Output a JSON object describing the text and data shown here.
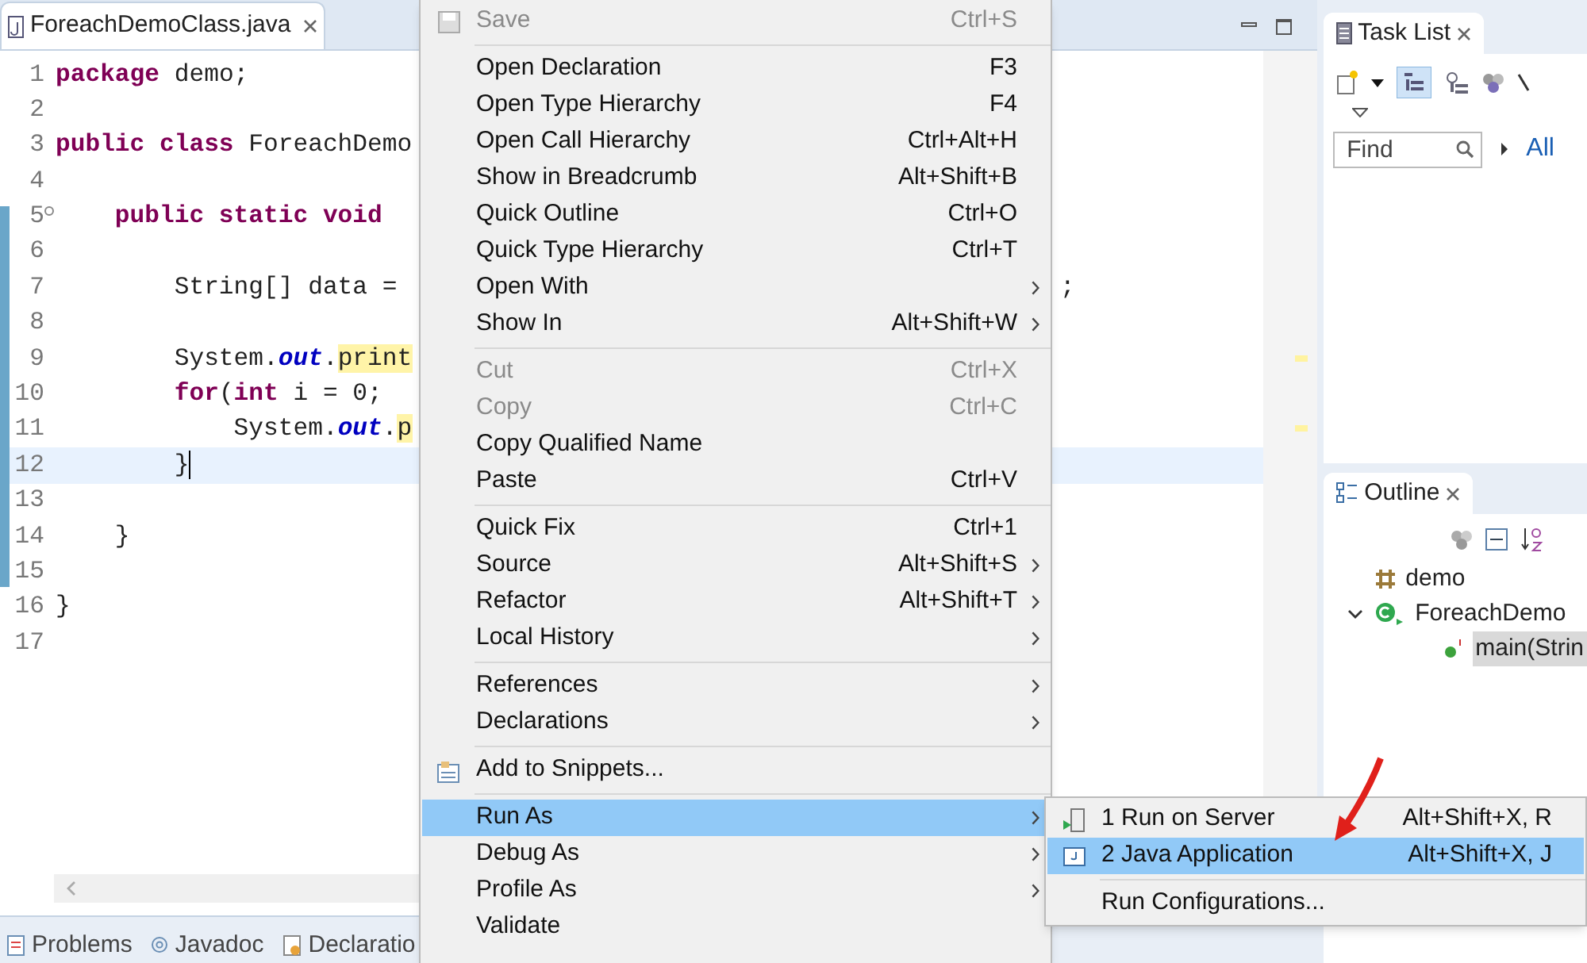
{
  "editor": {
    "tab": {
      "title": "ForeachDemoClass.java",
      "selected": true
    },
    "lines": [
      {
        "number": "1",
        "segments": [
          {
            "kind": "keyword",
            "text": "package"
          },
          {
            "kind": "plain",
            "text": " demo;"
          }
        ]
      },
      {
        "number": "2"
      },
      {
        "number": "3",
        "segments": [
          {
            "kind": "keyword",
            "text": "public class"
          },
          {
            "kind": "plain",
            "text": " ForeachDemo"
          }
        ]
      },
      {
        "number": "4"
      },
      {
        "number": "5",
        "fold": true,
        "segments": [
          {
            "kind": "keyword",
            "text": "    public static void"
          }
        ]
      },
      {
        "number": "6"
      },
      {
        "number": "7",
        "segments": [
          {
            "kind": "plain",
            "text": "        String[] data ="
          }
        ],
        "tail": ";"
      },
      {
        "number": "8"
      },
      {
        "number": "9",
        "segments": [
          {
            "kind": "plain",
            "text": "        System."
          },
          {
            "kind": "field",
            "text": "out"
          },
          {
            "kind": "plain",
            "text": "."
          },
          {
            "kind": "highlight",
            "text": "print"
          }
        ]
      },
      {
        "number": "10",
        "segments": [
          {
            "kind": "keyword",
            "text": "        for"
          },
          {
            "kind": "plain",
            "text": "("
          },
          {
            "kind": "keyword",
            "text": "int"
          },
          {
            "kind": "plain",
            "text": " i = 0;"
          }
        ]
      },
      {
        "number": "11",
        "segments": [
          {
            "kind": "plain",
            "text": "            System."
          },
          {
            "kind": "field",
            "text": "out"
          },
          {
            "kind": "plain",
            "text": "."
          },
          {
            "kind": "highlight",
            "text": "p"
          }
        ]
      },
      {
        "number": "12",
        "current": true,
        "segments": [
          {
            "kind": "plain",
            "text": "        }"
          }
        ]
      },
      {
        "number": "13"
      },
      {
        "number": "14",
        "segments": [
          {
            "kind": "plain",
            "text": "    }"
          }
        ]
      },
      {
        "number": "15"
      },
      {
        "number": "16",
        "segments": [
          {
            "kind": "plain",
            "text": "}"
          }
        ]
      },
      {
        "number": "17"
      }
    ]
  },
  "bottom_tabs": [
    {
      "label": "Problems"
    },
    {
      "label": "Javadoc"
    },
    {
      "label": "Declaratio"
    }
  ],
  "task_list": {
    "title": "Task List",
    "find": {
      "placeholder": "Find"
    },
    "filter_link": "All"
  },
  "outline": {
    "title": "Outline",
    "tree": [
      {
        "label": "demo",
        "kind": "package"
      },
      {
        "label": "ForeachDemo",
        "kind": "class",
        "expanded": true,
        "children": [
          {
            "label": "main(Strin",
            "kind": "method",
            "selected": true
          }
        ]
      }
    ]
  },
  "context_menu": [
    {
      "kind": "item",
      "label": "Save",
      "shortcut": "Ctrl+S",
      "disabled": true,
      "submenu": false,
      "selected": false
    },
    {
      "kind": "separator"
    },
    {
      "kind": "item",
      "label": "Open Declaration",
      "shortcut": "F3",
      "disabled": false,
      "submenu": false,
      "selected": false
    },
    {
      "kind": "item",
      "label": "Open Type Hierarchy",
      "shortcut": "F4",
      "disabled": false,
      "submenu": false,
      "selected": false
    },
    {
      "kind": "item",
      "label": "Open Call Hierarchy",
      "shortcut": "Ctrl+Alt+H",
      "disabled": false,
      "submenu": false,
      "selected": false
    },
    {
      "kind": "item",
      "label": "Show in Breadcrumb",
      "shortcut": "Alt+Shift+B",
      "disabled": false,
      "submenu": false,
      "selected": false
    },
    {
      "kind": "item",
      "label": "Quick Outline",
      "shortcut": "Ctrl+O",
      "disabled": false,
      "submenu": false,
      "selected": false
    },
    {
      "kind": "item",
      "label": "Quick Type Hierarchy",
      "shortcut": "Ctrl+T",
      "disabled": false,
      "submenu": false,
      "selected": false
    },
    {
      "kind": "item",
      "label": "Open With",
      "disabled": false,
      "submenu": true,
      "selected": false
    },
    {
      "kind": "item",
      "label": "Show In",
      "shortcut": "Alt+Shift+W",
      "disabled": false,
      "submenu": true,
      "selected": false
    },
    {
      "kind": "separator"
    },
    {
      "kind": "item",
      "label": "Cut",
      "shortcut": "Ctrl+X",
      "disabled": true,
      "submenu": false,
      "selected": false
    },
    {
      "kind": "item",
      "label": "Copy",
      "shortcut": "Ctrl+C",
      "disabled": true,
      "submenu": false,
      "selected": false
    },
    {
      "kind": "item",
      "label": "Copy Qualified Name",
      "disabled": false,
      "submenu": false,
      "selected": false
    },
    {
      "kind": "item",
      "label": "Paste",
      "shortcut": "Ctrl+V",
      "disabled": false,
      "submenu": false,
      "selected": false
    },
    {
      "kind": "separator"
    },
    {
      "kind": "item",
      "label": "Quick Fix",
      "shortcut": "Ctrl+1",
      "disabled": false,
      "submenu": false,
      "selected": false
    },
    {
      "kind": "item",
      "label": "Source",
      "shortcut": "Alt+Shift+S",
      "disabled": false,
      "submenu": true,
      "selected": false
    },
    {
      "kind": "item",
      "label": "Refactor",
      "shortcut": "Alt+Shift+T",
      "disabled": false,
      "submenu": true,
      "selected": false
    },
    {
      "kind": "item",
      "label": "Local History",
      "disabled": false,
      "submenu": true,
      "selected": false
    },
    {
      "kind": "separator"
    },
    {
      "kind": "item",
      "label": "References",
      "disabled": false,
      "submenu": true,
      "selected": false
    },
    {
      "kind": "item",
      "label": "Declarations",
      "disabled": false,
      "submenu": true,
      "selected": false
    },
    {
      "kind": "separator"
    },
    {
      "kind": "item",
      "label": "Add to Snippets...",
      "disabled": false,
      "submenu": false,
      "selected": false
    },
    {
      "kind": "separator"
    },
    {
      "kind": "item",
      "label": "Run As",
      "disabled": false,
      "submenu": true,
      "selected": true
    },
    {
      "kind": "item",
      "label": "Debug As",
      "disabled": false,
      "submenu": true,
      "selected": false
    },
    {
      "kind": "item",
      "label": "Profile As",
      "disabled": false,
      "submenu": true,
      "selected": false
    },
    {
      "kind": "item",
      "label": "Validate",
      "disabled": false,
      "submenu": false,
      "selected": false
    }
  ],
  "run_as_submenu": [
    {
      "kind": "item",
      "label": "1 Run on Server",
      "shortcut": "Alt+Shift+X, R",
      "selected": false
    },
    {
      "kind": "item",
      "label": "2 Java Application",
      "shortcut": "Alt+Shift+X, J",
      "selected": true
    },
    {
      "kind": "separator"
    },
    {
      "kind": "item",
      "label": "Run Configurations...",
      "selected": false
    }
  ]
}
